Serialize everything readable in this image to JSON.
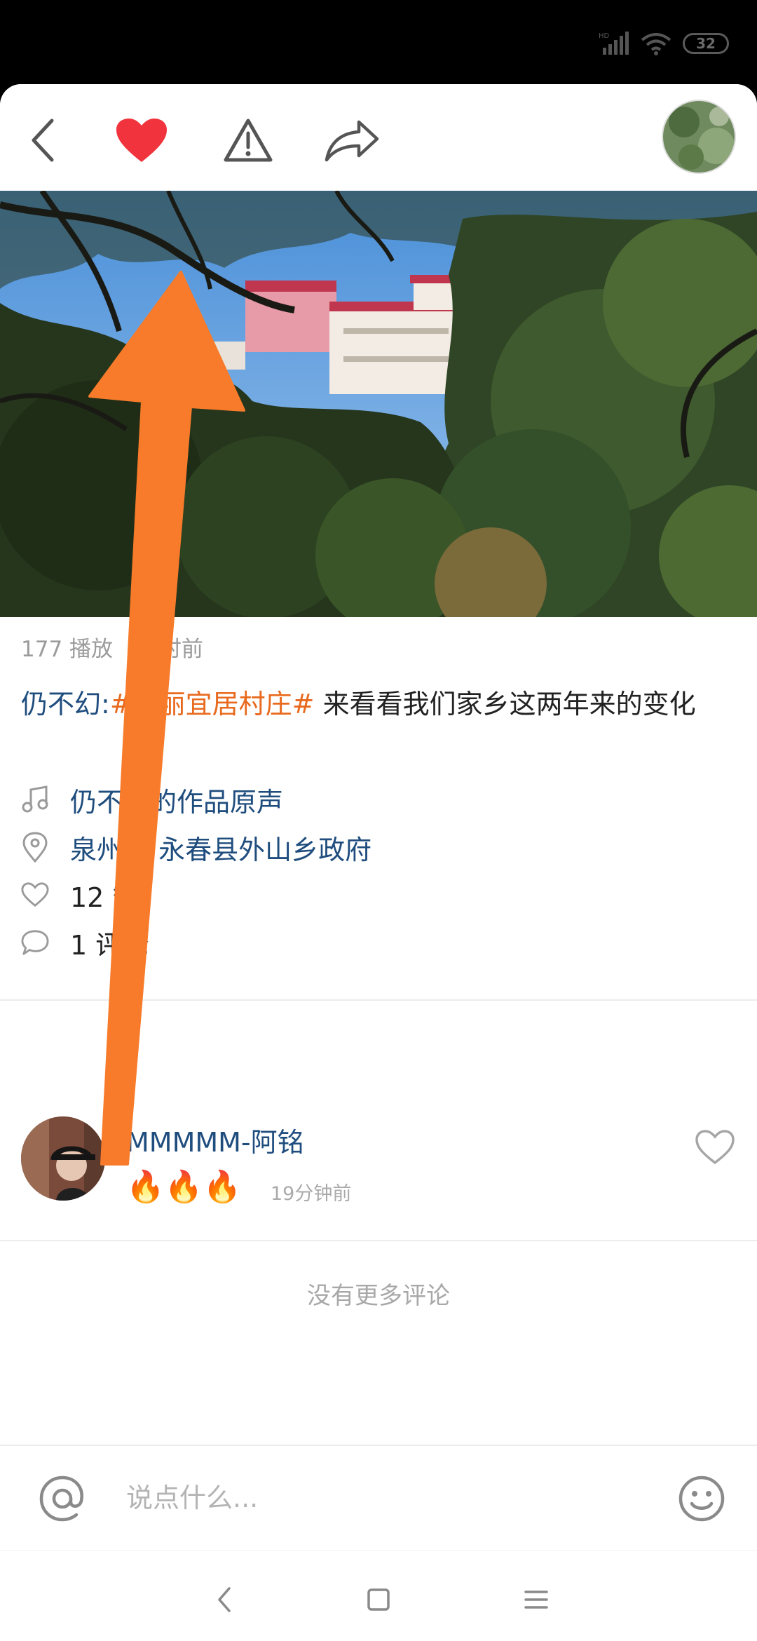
{
  "status_bar": {
    "network": "HD",
    "battery": "32"
  },
  "video": {
    "plays": "177 播放",
    "time_ago": "小时前"
  },
  "post": {
    "author": "仍不幻:",
    "tag": "#美丽宜居村庄#",
    "text": " 来看看我们家乡这两年来的变化"
  },
  "info": {
    "music": "仍不幻的作品原声",
    "location": "泉州市 永春县外山乡政府",
    "likes": "12 赞",
    "comments": "1 评论"
  },
  "comment": {
    "name": "MMMMM-阿铭",
    "body": "🔥🔥🔥",
    "time": "19分钟前"
  },
  "no_more": "没有更多评论",
  "input": {
    "placeholder": "说点什么..."
  },
  "colors": {
    "accent": "#e86a1e",
    "link": "#1f4d7e",
    "like": "#f0333c",
    "overlay_arrow": "#f77b2a"
  }
}
